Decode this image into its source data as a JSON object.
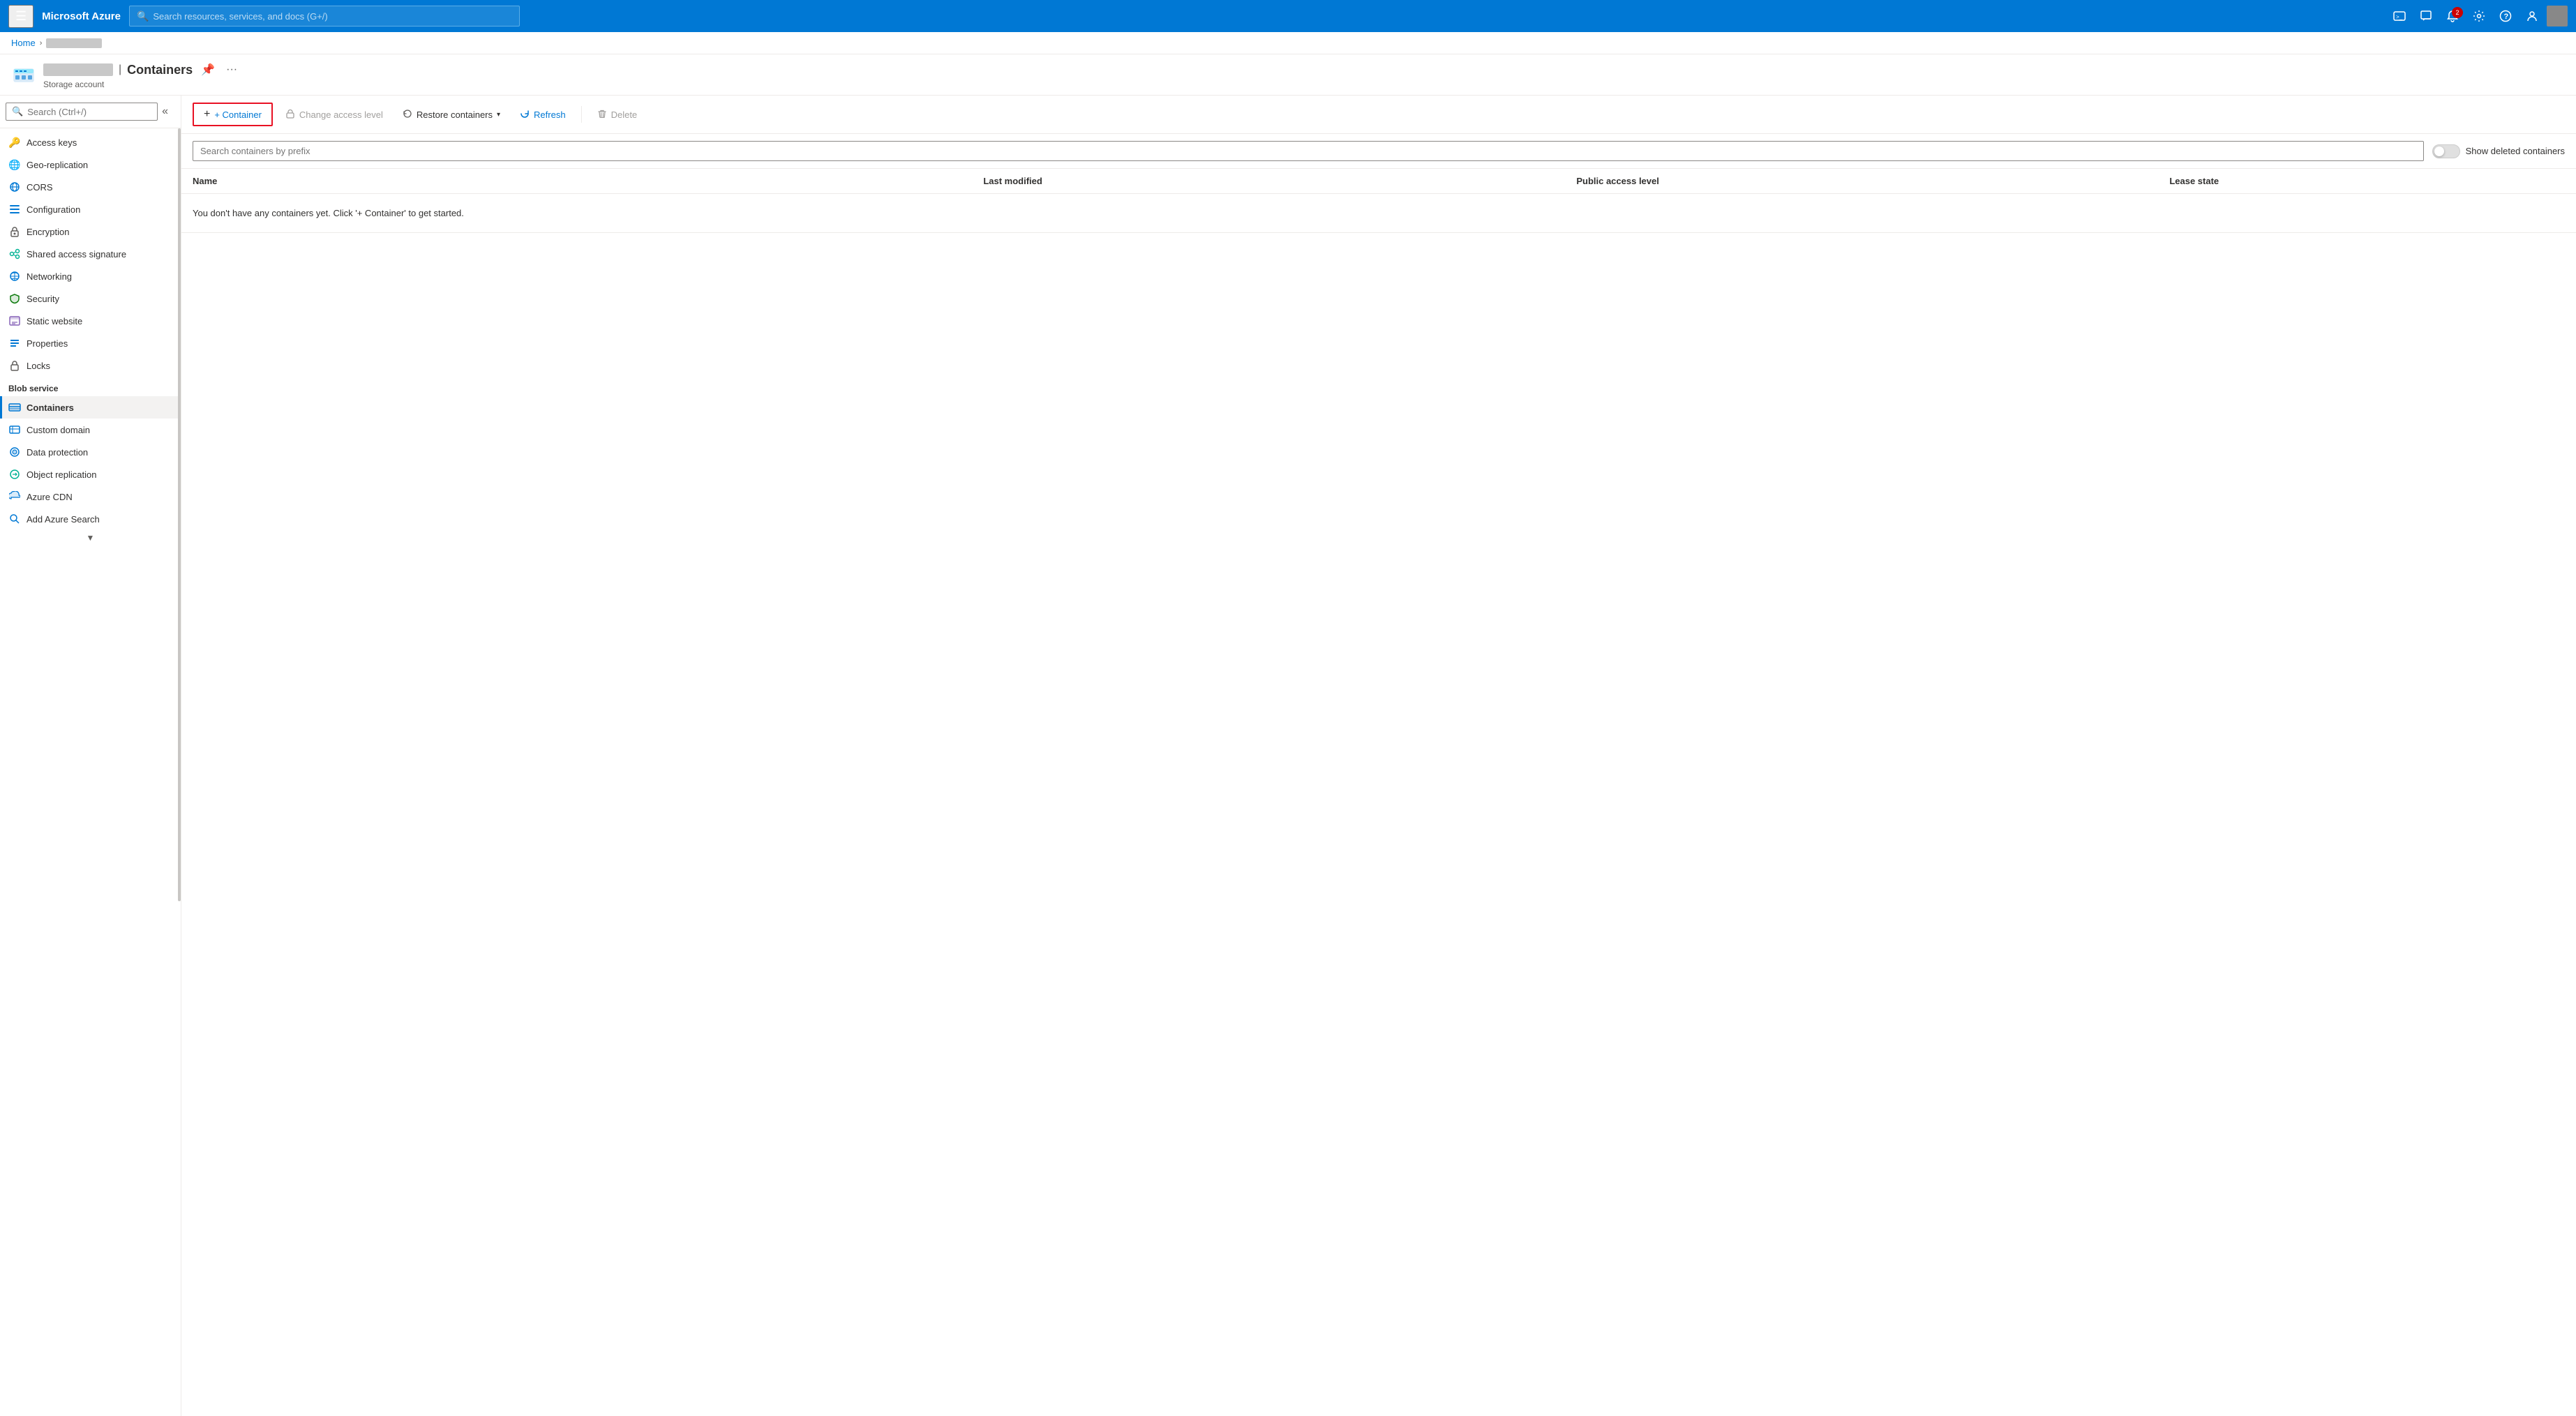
{
  "topbar": {
    "brand": "Microsoft Azure",
    "search_placeholder": "Search resources, services, and docs (G+/)",
    "notification_count": "2"
  },
  "breadcrumb": {
    "home": "Home",
    "account": ""
  },
  "page_header": {
    "title": "Containers",
    "subtitle": "Storage account",
    "blurred_label": ""
  },
  "sidebar": {
    "search_placeholder": "Search (Ctrl+/)",
    "items": [
      {
        "id": "access-keys",
        "label": "Access keys",
        "icon": "key"
      },
      {
        "id": "geo-replication",
        "label": "Geo-replication",
        "icon": "globe"
      },
      {
        "id": "cors",
        "label": "CORS",
        "icon": "cors"
      },
      {
        "id": "configuration",
        "label": "Configuration",
        "icon": "config"
      },
      {
        "id": "encryption",
        "label": "Encryption",
        "icon": "lock"
      },
      {
        "id": "shared-access-signature",
        "label": "Shared access signature",
        "icon": "shared"
      },
      {
        "id": "networking",
        "label": "Networking",
        "icon": "network"
      },
      {
        "id": "security",
        "label": "Security",
        "icon": "shield"
      },
      {
        "id": "static-website",
        "label": "Static website",
        "icon": "static"
      },
      {
        "id": "properties",
        "label": "Properties",
        "icon": "props"
      },
      {
        "id": "locks",
        "label": "Locks",
        "icon": "lock2"
      }
    ],
    "blob_service_label": "Blob service",
    "blob_items": [
      {
        "id": "containers",
        "label": "Containers",
        "icon": "containers",
        "active": true
      },
      {
        "id": "custom-domain",
        "label": "Custom domain",
        "icon": "domain"
      },
      {
        "id": "data-protection",
        "label": "Data protection",
        "icon": "data-prot"
      },
      {
        "id": "object-replication",
        "label": "Object replication",
        "icon": "obj-rep"
      },
      {
        "id": "azure-cdn",
        "label": "Azure CDN",
        "icon": "cdn"
      },
      {
        "id": "add-azure-search",
        "label": "Add Azure Search",
        "icon": "search2"
      }
    ]
  },
  "toolbar": {
    "add_container_label": "+ Container",
    "change_access_label": "Change access level",
    "restore_containers_label": "Restore containers",
    "refresh_label": "Refresh",
    "delete_label": "Delete"
  },
  "search": {
    "placeholder": "Search containers by prefix"
  },
  "toggle": {
    "label": "Show deleted containers"
  },
  "table": {
    "columns": [
      "Name",
      "Last modified",
      "Public access level",
      "Lease state"
    ],
    "empty_message": "You don't have any containers yet. Click '+ Container' to get started."
  }
}
